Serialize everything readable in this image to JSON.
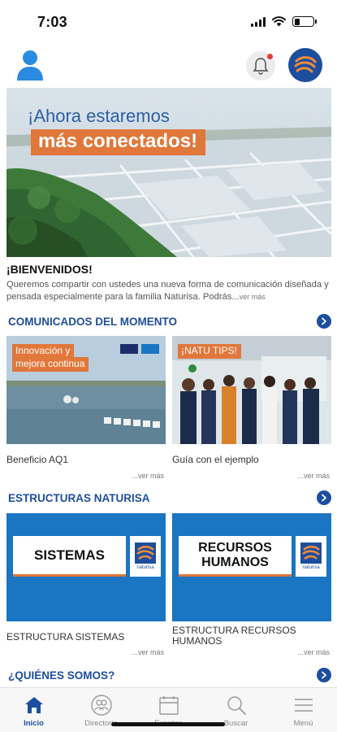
{
  "status_bar": {
    "time": "7:03"
  },
  "header": {
    "profile_icon": "user-icon",
    "notification_icon": "bell-icon",
    "brand_icon": "naturisa-logo-icon"
  },
  "hero": {
    "line1": "¡Ahora estaremos",
    "line2": "más conectados!"
  },
  "welcome": {
    "title": "¡BIENVENIDOS!",
    "text": "Queremos compartir con ustedes una nueva forma de comunicación diseñada y pensada especialmente para la familia Naturisa. Podrás...",
    "more": "ver más"
  },
  "communications": {
    "title": "COMUNICADOS DEL MOMENTO",
    "cards": [
      {
        "tag_line1": "Innovación y",
        "tag_line2": "mejora continua",
        "title": "Beneficio AQ1",
        "more": "...ver más"
      },
      {
        "tag": "¡NATU TIPS!",
        "title": "Guía con el ejemplo",
        "more": "...ver más"
      }
    ]
  },
  "structures": {
    "title": "ESTRUCTURAS NATURISA",
    "cards": [
      {
        "box_text": "SISTEMAS",
        "title": "ESTRUCTURA SISTEMAS",
        "more": "...ver más",
        "logo_text": "naturisa"
      },
      {
        "box_line1": "RECURSOS",
        "box_line2": "HUMANOS",
        "title": "ESTRUCTURA RECURSOS HUMANOS",
        "more": "...ver más",
        "logo_text": "naturisa"
      }
    ]
  },
  "about": {
    "title": "¿QUIÉNES SOMOS?"
  },
  "bottom_nav": [
    {
      "label": "Inicio",
      "icon": "home-icon",
      "active": true
    },
    {
      "label": "Directorio",
      "icon": "directory-icon"
    },
    {
      "label": "Eventos",
      "icon": "calendar-icon"
    },
    {
      "label": "Buscar",
      "icon": "search-icon"
    },
    {
      "label": "Menú",
      "icon": "menu-icon"
    }
  ],
  "colors": {
    "primary": "#1d4e9e",
    "accent": "#e1773a",
    "tile_blue": "#1a75c2"
  }
}
